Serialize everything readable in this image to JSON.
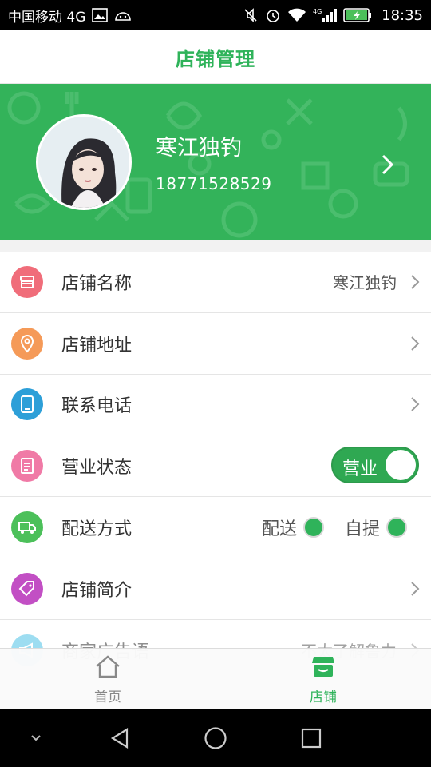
{
  "status_bar": {
    "carrier": "中国移动 4G",
    "network_badge": "4G",
    "time": "18:35"
  },
  "header": {
    "title": "店铺管理"
  },
  "profile": {
    "name": "寒江独钓",
    "phone": "18771528529"
  },
  "settings": {
    "shop_name": {
      "label": "店铺名称",
      "value": "寒江独钓",
      "icon": "store-icon",
      "color": "#f06d7a"
    },
    "shop_address": {
      "label": "店铺地址",
      "icon": "location-pin-icon",
      "color": "#f59a58"
    },
    "contact_phone": {
      "label": "联系电话",
      "icon": "phone-icon",
      "color": "#2d9fd8"
    },
    "business_status": {
      "label": "营业状态",
      "toggle_text": "营业",
      "toggle_on": true,
      "icon": "clipboard-icon",
      "color": "#f07aa6"
    },
    "delivery_method": {
      "label": "配送方式",
      "option_delivery": "配送",
      "option_pickup": "自提",
      "icon": "truck-icon",
      "color": "#4cc05a"
    },
    "shop_intro": {
      "label": "店铺简介",
      "icon": "tag-icon",
      "color": "#c24fc4"
    },
    "merchant_slogan": {
      "label": "商家广告语",
      "value": "不太了解鲁力",
      "icon": "megaphone-icon",
      "color": "#4ec3e6"
    }
  },
  "tabbar": {
    "home": {
      "label": "首页",
      "icon": "home-icon"
    },
    "shop": {
      "label": "店铺",
      "icon": "shop-icon"
    }
  },
  "colors": {
    "accent": "#2fb35a"
  }
}
